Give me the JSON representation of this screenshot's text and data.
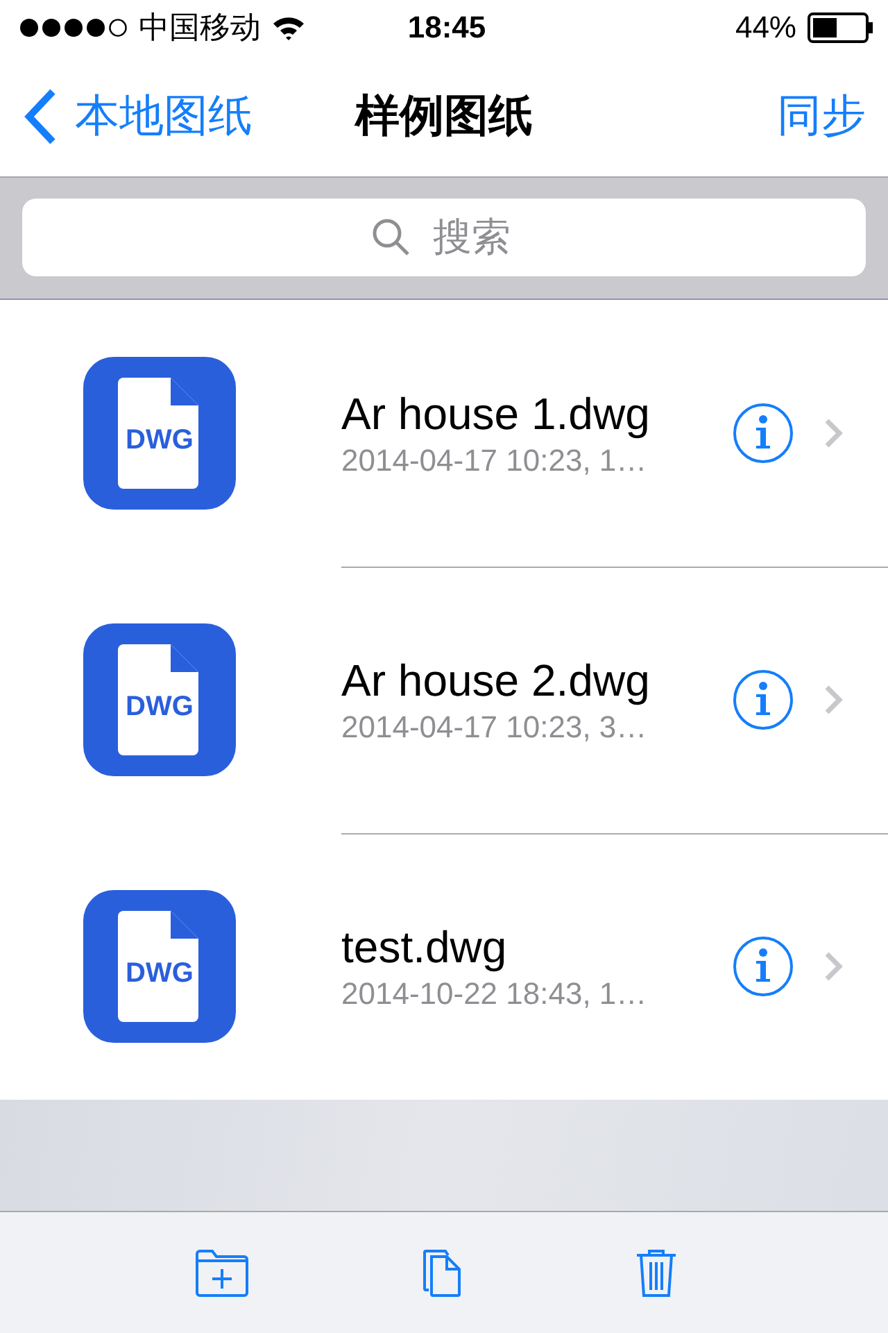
{
  "status_bar": {
    "carrier": "中国移动",
    "time": "18:45",
    "battery": "44%"
  },
  "nav": {
    "back": "本地图纸",
    "title": "样例图纸",
    "action": "同步"
  },
  "search": {
    "placeholder": "搜索"
  },
  "files": [
    {
      "name": "Ar house 1.dwg",
      "detail": "2014-04-17 10:23, 1…",
      "icon_label": "DWG"
    },
    {
      "name": "Ar house 2.dwg",
      "detail": "2014-04-17 10:23, 3…",
      "icon_label": "DWG"
    },
    {
      "name": "test.dwg",
      "detail": "2014-10-22 18:43, 1…",
      "icon_label": "DWG"
    }
  ],
  "toolbar": [
    {
      "kind": "new-folder"
    },
    {
      "kind": "copy"
    },
    {
      "kind": "trash"
    }
  ]
}
